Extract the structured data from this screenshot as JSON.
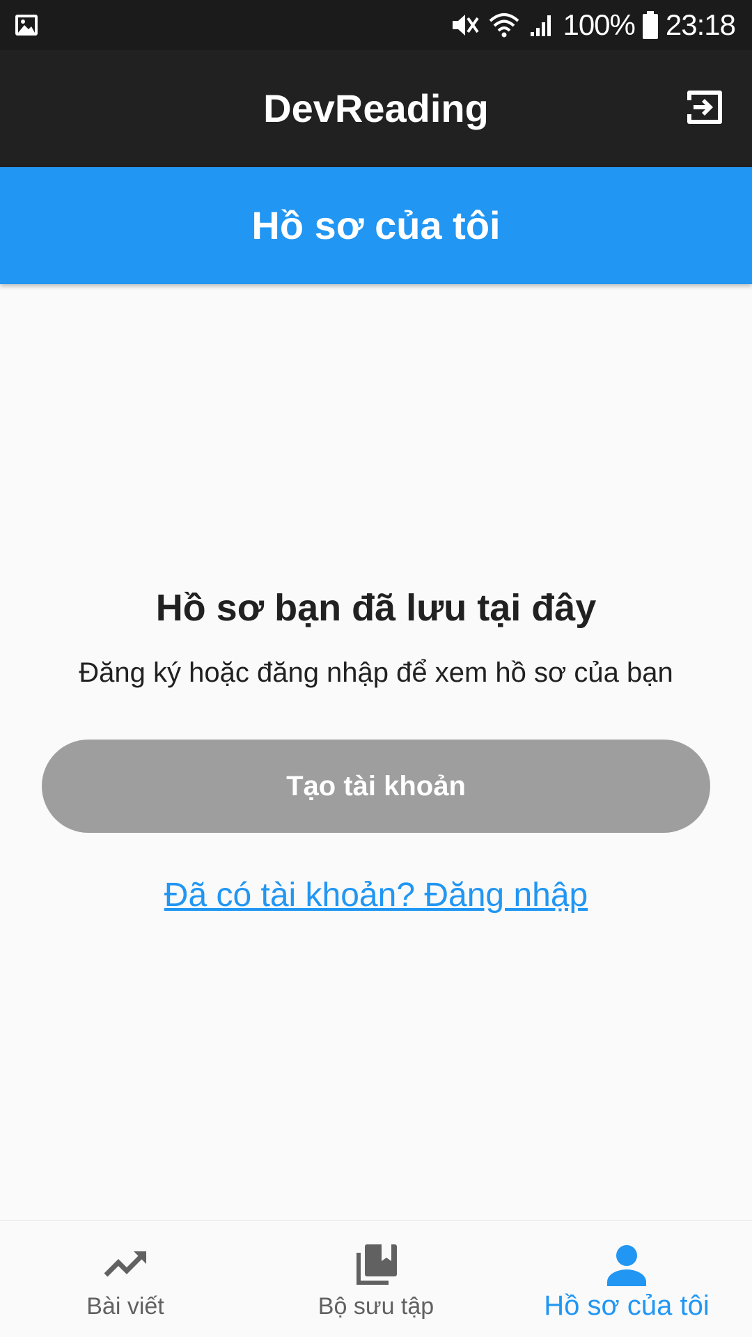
{
  "status_bar": {
    "battery": "100%",
    "time": "23:18",
    "icons": [
      "image-icon",
      "mute-icon",
      "wifi-icon",
      "signal-icon",
      "battery-icon"
    ]
  },
  "app_bar": {
    "title": "DevReading",
    "exit_icon": "exit-icon"
  },
  "section_header": {
    "title": "Hồ sơ của tôi"
  },
  "empty_state": {
    "title": "Hồ sơ bạn đã lưu tại đây",
    "subtitle": "Đăng ký hoặc đăng nhập để xem hồ sơ của bạn",
    "create_account_label": "Tạo tài khoản",
    "login_link_label": "Đã có tài khoản? Đăng nhập"
  },
  "bottom_nav": {
    "items": [
      {
        "label": "Bài viết",
        "icon": "trending-up-icon",
        "active": false
      },
      {
        "label": "Bộ sưu tập",
        "icon": "collections-icon",
        "active": false
      },
      {
        "label": "Hồ sơ của tôi",
        "icon": "person-icon",
        "active": true
      }
    ]
  },
  "colors": {
    "status_bar_bg": "#1b1b1b",
    "app_bar_bg": "#212121",
    "accent": "#2196f3",
    "button_disabled": "#9e9e9e",
    "background": "#fafafa",
    "inactive": "#616161"
  }
}
